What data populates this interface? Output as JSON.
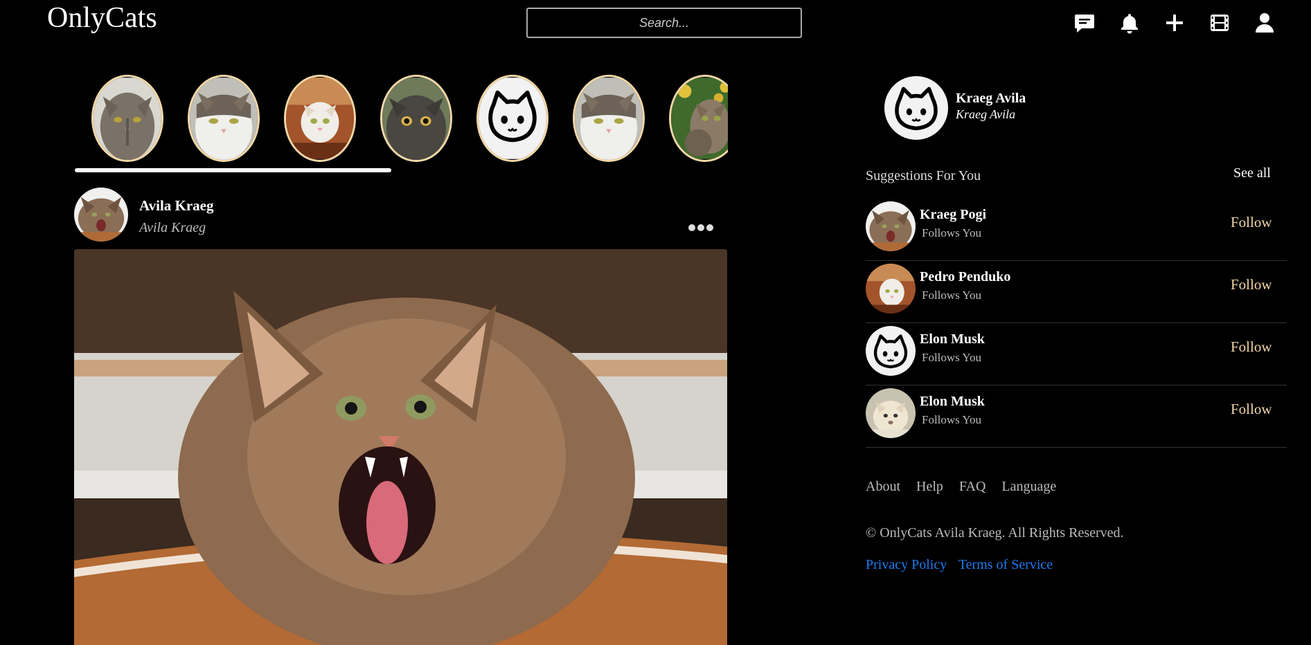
{
  "app": {
    "logo": "OnlyCats"
  },
  "search": {
    "placeholder": "Search..."
  },
  "nav": {
    "icons": [
      "message-icon",
      "bell-icon",
      "plus-icon",
      "film-icon",
      "user-icon"
    ]
  },
  "stories": [
    {
      "icon": "tabby-cat-photo"
    },
    {
      "icon": "white-tabby-cat-photo"
    },
    {
      "icon": "cat-in-paper-bag-photo"
    },
    {
      "icon": "grey-cat-photo"
    },
    {
      "icon": "default-cat-avatar"
    },
    {
      "icon": "white-tabby-cat-photo"
    },
    {
      "icon": "kitten-in-flowers-photo"
    }
  ],
  "post": {
    "author_name": "Avila Kraeg",
    "author_handle": "Avila Kraeg",
    "image_icon": "yawning-longhair-cat-photo"
  },
  "profile": {
    "name": "Kraeg Avila",
    "handle": "Kraeg Avila"
  },
  "suggestions": {
    "title": "Suggestions For You",
    "see_all": "See all",
    "items": [
      {
        "name": "Kraeg Pogi",
        "sub": "Follows You",
        "action": "Follow"
      },
      {
        "name": "Pedro Penduko",
        "sub": "Follows You",
        "action": "Follow"
      },
      {
        "name": "Elon Musk",
        "sub": "Follows You",
        "action": "Follow"
      },
      {
        "name": "Elon Musk",
        "sub": "Follows You",
        "action": "Follow"
      }
    ]
  },
  "footer": {
    "links": [
      "About",
      "Help",
      "FAQ",
      "Language"
    ],
    "copyright": "© OnlyCats Avila Kraeg. All Rights Reserved.",
    "privacy": "Privacy Policy",
    "terms": "Terms of Service"
  },
  "colors": {
    "background": "#000000",
    "accent": "#f2d7a8",
    "link": "#1e7bf0"
  }
}
